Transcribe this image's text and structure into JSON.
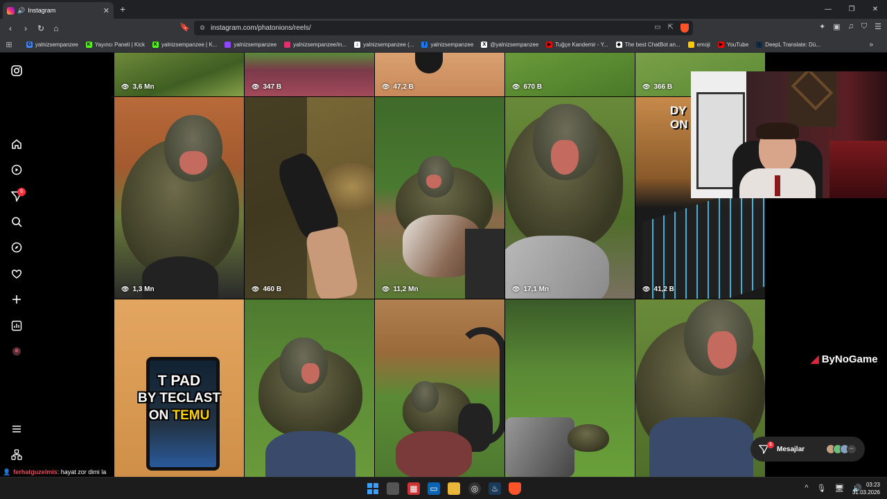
{
  "browser": {
    "tab_title": "Instagram",
    "url": "instagram.com/phatonions/reels/",
    "bookmarks": [
      {
        "label": "yalnizsempanzee",
        "color": "#4285f4",
        "glyph": "G"
      },
      {
        "label": "Yayıncı Paneli | Kick",
        "color": "#53fc18",
        "glyph": "K"
      },
      {
        "label": "yalnizsempanzee | K...",
        "color": "#53fc18",
        "glyph": "K"
      },
      {
        "label": "yalnizsempanzee",
        "color": "#9146ff",
        "glyph": ""
      },
      {
        "label": "yalnizsempanzee/in...",
        "color": "#e1306c",
        "glyph": ""
      },
      {
        "label": "yalnizsempanzee (...",
        "color": "#ffffff",
        "glyph": "♪"
      },
      {
        "label": "yalnizsempanzee",
        "color": "#1877f2",
        "glyph": "f"
      },
      {
        "label": "@yalnizsempanzee",
        "color": "#ffffff",
        "glyph": "X"
      },
      {
        "label": "Tuğçe Kandemir - Y...",
        "color": "#ff0000",
        "glyph": "▶"
      },
      {
        "label": "The best ChatBot an...",
        "color": "#ffffff",
        "glyph": "◆"
      },
      {
        "label": "emoji",
        "color": "#ffcc00",
        "glyph": ""
      },
      {
        "label": "YouTube",
        "color": "#ff0000",
        "glyph": "▶"
      },
      {
        "label": "DeepL Translate: Dü...",
        "color": "#0f2b46",
        "glyph": "›"
      }
    ]
  },
  "sidebar": {
    "notification_count": "6"
  },
  "reels": {
    "row0": [
      "3,6 Mn",
      "347 B",
      "47,2 B",
      "670 B",
      "366 B"
    ],
    "row1": [
      "1,3 Mn",
      "460 B",
      "11,2 Mn",
      "17,1 Mn",
      "41,2 B"
    ],
    "tpad_lines": [
      "T PAD",
      "BY TECLAST",
      "ON ",
      "TEMU"
    ],
    "overlay_text": [
      "DY",
      "ON"
    ]
  },
  "overlay": {
    "watermark": "ByNoGame"
  },
  "messages": {
    "label": "Mesajlar",
    "count": "5"
  },
  "chat": {
    "user": "ferhatguzelmis",
    "text": ": hayat zor dimi la"
  },
  "clock": {
    "time": "03:23",
    "date": "31.03.2026"
  }
}
